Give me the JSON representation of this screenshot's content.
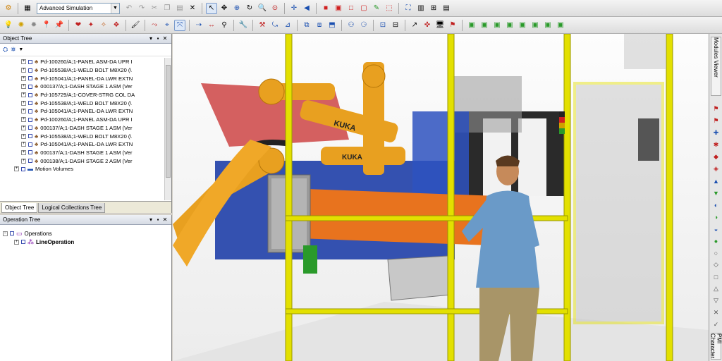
{
  "toolbar": {
    "simulation_mode": "Advanced Simulation"
  },
  "object_tree": {
    "title": "Object Tree",
    "items": [
      "Pd-100260/A;1-PANEL ASM-DA UPR I",
      "Pd-105538/A;1-WELD BOLT M8X20 (\\",
      "Pd-105041/A;1-PANEL-DA LWR EXTN",
      "000137/A;1-DASH STAGE 1 ASM (Ver",
      "Pd-105729/A;1-COVER-STRG COL DA",
      "Pd-105538/A;1-WELD BOLT M8X20 (\\",
      "Pd-105041/A;1-PANEL-DA LWR EXTN",
      "Pd-100260/A;1-PANEL ASM-DA UPR I",
      "000137/A;1-DASH STAGE 1 ASM (Ver",
      "Pd-105538/A;1-WELD BOLT M8X20 (\\",
      "Pd-105041/A;1-PANEL-DA LWR EXTN",
      "000137/A;1-DASH STAGE 1 ASM (Ver",
      "000138/A;1-DASH STAGE 2 ASM (Ver"
    ],
    "motion_volumes": "Motion Volumes",
    "tabs": [
      "Object Tree",
      "Logical Collections Tree"
    ]
  },
  "operation_tree": {
    "title": "Operation Tree",
    "root": "Operations",
    "child": "LineOperation"
  },
  "right_strip": {
    "tab_top": "Modules Viewer",
    "tab_bottom": "PMI Character"
  },
  "viewport": {
    "robot_brand": "KUKA"
  },
  "colors": {
    "robot_orange": "#e8a020",
    "fence_yellow": "#e3e000",
    "fixture_blue": "#1f3fa8",
    "panel_red": "#d46060"
  }
}
